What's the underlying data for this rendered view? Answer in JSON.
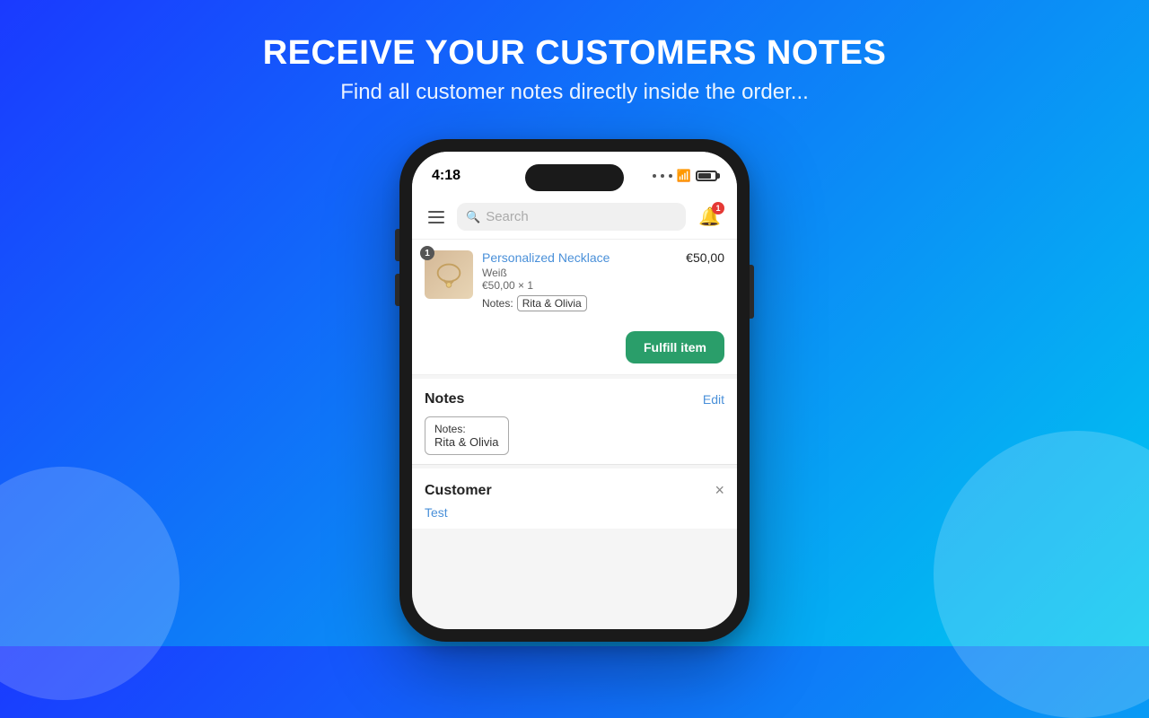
{
  "background": {
    "gradient_start": "#1a3aff",
    "gradient_end": "#00c8f0"
  },
  "header": {
    "main_title": "RECEIVE YOUR CUSTOMERS NOTES",
    "sub_title": "Find all customer notes directly inside the order..."
  },
  "phone": {
    "status_bar": {
      "time": "4:18",
      "badge_count": "1"
    },
    "topbar": {
      "search_placeholder": "Search",
      "bell_badge": "1"
    },
    "order_item": {
      "badge": "1",
      "title": "Personalized Necklace",
      "variant": "Weiß",
      "price_qty": "€50,00 × 1",
      "notes_label": "Notes:",
      "notes_value": "Rita & Olivia",
      "price": "€50,00"
    },
    "fulfill_button": "Fulfill item",
    "notes_section": {
      "title": "Notes",
      "edit_label": "Edit",
      "notes_label": "Notes:",
      "notes_value": "Rita & Olivia"
    },
    "customer_section": {
      "title": "Customer",
      "customer_name": "Test"
    }
  }
}
